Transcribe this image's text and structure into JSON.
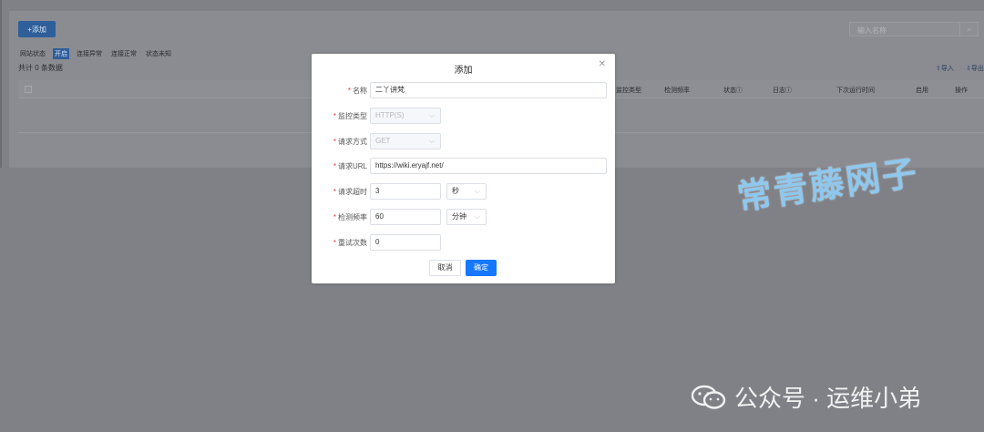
{
  "background": {
    "add_button": "+添加",
    "search_placeholder": "输入名称",
    "search_icon": "search-icon",
    "filters": [
      "网站状态",
      "开启",
      "连接异常",
      "连接正常",
      "状态未知"
    ],
    "count_text": "共计 0 条数据",
    "import_label": "导入",
    "export_label": "导出",
    "columns": [
      "监控类型",
      "检测频率",
      "状态",
      "日志",
      "下次运行时间",
      "启用",
      "操作"
    ]
  },
  "modal": {
    "title": "添加",
    "close_icon": "close-icon",
    "fields": {
      "name": {
        "label": "名称",
        "value": "二丫讲梵"
      },
      "monitor_type": {
        "label": "监控类型",
        "value": "HTTP(S)"
      },
      "method": {
        "label": "请求方式",
        "value": "GET"
      },
      "url": {
        "label": "请求URL",
        "value": "https://wiki.eryajf.net/"
      },
      "timeout": {
        "label": "请求超时",
        "value": "3",
        "unit": "秒"
      },
      "frequency": {
        "label": "检测频率",
        "value": "60",
        "unit": "分钟"
      },
      "retries": {
        "label": "重试次数",
        "value": "0"
      }
    },
    "cancel_label": "取消",
    "ok_label": "确定"
  },
  "watermark": {
    "brand": "常青藤网子",
    "footer": "公众号 · 运维小弟"
  },
  "colors": {
    "primary": "#1677ff",
    "required": "#e53935"
  }
}
